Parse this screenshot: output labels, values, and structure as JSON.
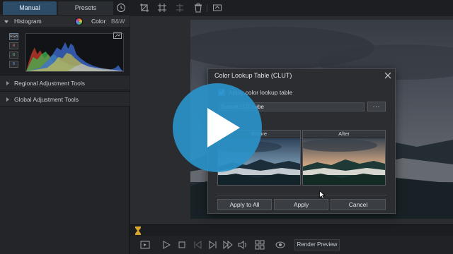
{
  "tabs": {
    "manual": "Manual",
    "presets": "Presets"
  },
  "histogram": {
    "title": "Histogram",
    "color": "Color",
    "bw": "B&W",
    "channels": [
      "RGB",
      "R",
      "G",
      "B"
    ]
  },
  "sections": [
    {
      "label": "Regional Adjustment Tools"
    },
    {
      "label": "Global Adjustment Tools"
    }
  ],
  "dialog": {
    "title": "Color Lookup Table (CLUT)",
    "checkbox_label": "Apply color lookup table",
    "checked": true,
    "file_value": "Sunset LUT.cube",
    "browse_label": "...",
    "before_label": "Before",
    "after_label": "After",
    "buttons": {
      "apply_all": "Apply to All",
      "apply": "Apply",
      "cancel": "Cancel"
    }
  },
  "bottom": {
    "render_preview": "Render Preview"
  },
  "icons": {
    "toolbar": [
      "crop-icon",
      "align-icon",
      "compare-icon",
      "trash-icon",
      "fit-icon"
    ],
    "playback": [
      "preview-icon",
      "play-icon",
      "stop-icon",
      "prev-frame-icon",
      "next-frame-icon",
      "fast-forward-icon",
      "volume-icon",
      "grid-icon",
      "eye-icon"
    ]
  },
  "colors": {
    "accent": "#2f7ad6",
    "overlay_play": "#2a93c9",
    "tab_active": "#2d4c68"
  }
}
